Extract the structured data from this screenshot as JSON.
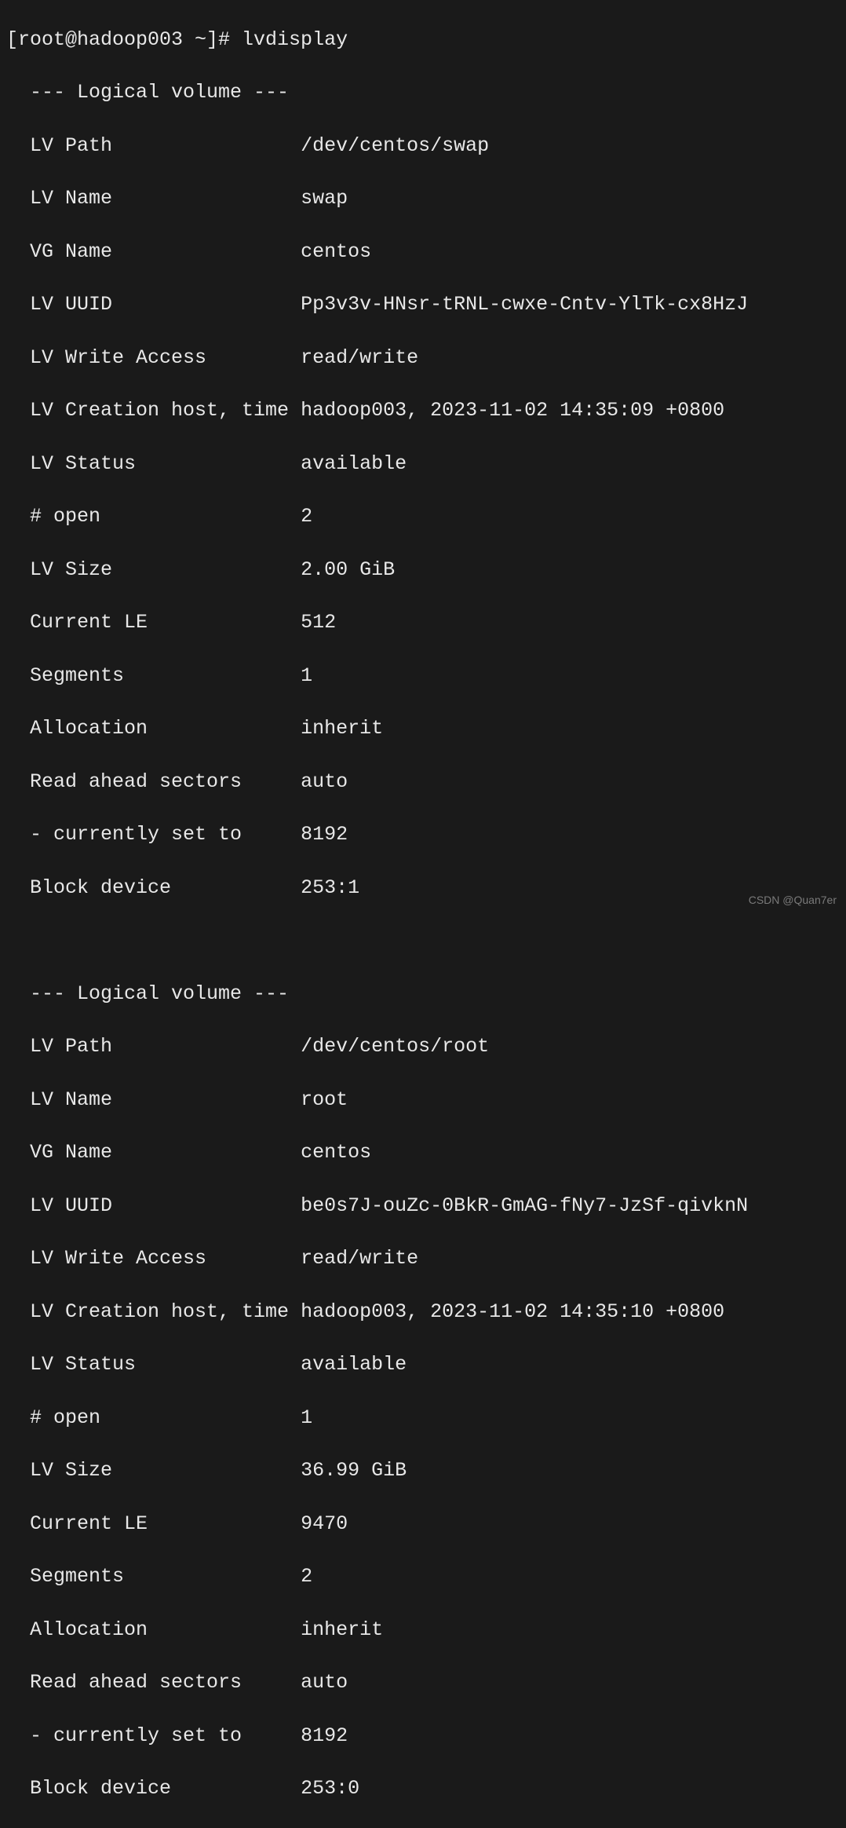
{
  "prompt": "[root@hadoop003 ~]# lvdisplay",
  "volumes": [
    {
      "header": "  --- Logical volume ---",
      "rows": [
        {
          "label": "  LV Path",
          "value": "/dev/centos/swap"
        },
        {
          "label": "  LV Name",
          "value": "swap"
        },
        {
          "label": "  VG Name",
          "value": "centos"
        },
        {
          "label": "  LV UUID",
          "value": "Pp3v3v-HNsr-tRNL-cwxe-Cntv-YlTk-cx8HzJ"
        },
        {
          "label": "  LV Write Access",
          "value": "read/write"
        },
        {
          "label": "  LV Creation host, time",
          "value": "hadoop003, 2023-11-02 14:35:09 +0800"
        },
        {
          "label": "  LV Status",
          "value": "available"
        },
        {
          "label": "  # open",
          "value": "2"
        },
        {
          "label": "  LV Size",
          "value": "2.00 GiB"
        },
        {
          "label": "  Current LE",
          "value": "512"
        },
        {
          "label": "  Segments",
          "value": "1"
        },
        {
          "label": "  Allocation",
          "value": "inherit"
        },
        {
          "label": "  Read ahead sectors",
          "value": "auto"
        },
        {
          "label": "  - currently set to",
          "value": "8192"
        },
        {
          "label": "  Block device",
          "value": "253:1"
        }
      ]
    },
    {
      "header": "  --- Logical volume ---",
      "rows": [
        {
          "label": "  LV Path",
          "value": "/dev/centos/root"
        },
        {
          "label": "  LV Name",
          "value": "root"
        },
        {
          "label": "  VG Name",
          "value": "centos"
        },
        {
          "label": "  LV UUID",
          "value": "be0s7J-ouZc-0BkR-GmAG-fNy7-JzSf-qivknN"
        },
        {
          "label": "  LV Write Access",
          "value": "read/write"
        },
        {
          "label": "  LV Creation host, time",
          "value": "hadoop003, 2023-11-02 14:35:10 +0800"
        },
        {
          "label": "  LV Status",
          "value": "available"
        },
        {
          "label": "  # open",
          "value": "1"
        },
        {
          "label": "  LV Size",
          "value": "36.99 GiB"
        },
        {
          "label": "  Current LE",
          "value": "9470"
        },
        {
          "label": "  Segments",
          "value": "2"
        },
        {
          "label": "  Allocation",
          "value": "inherit"
        },
        {
          "label": "  Read ahead sectors",
          "value": "auto"
        },
        {
          "label": "  - currently set to",
          "value": "8192"
        },
        {
          "label": "  Block device",
          "value": "253:0"
        }
      ]
    }
  ],
  "watermark": "CSDN @Quan7er"
}
